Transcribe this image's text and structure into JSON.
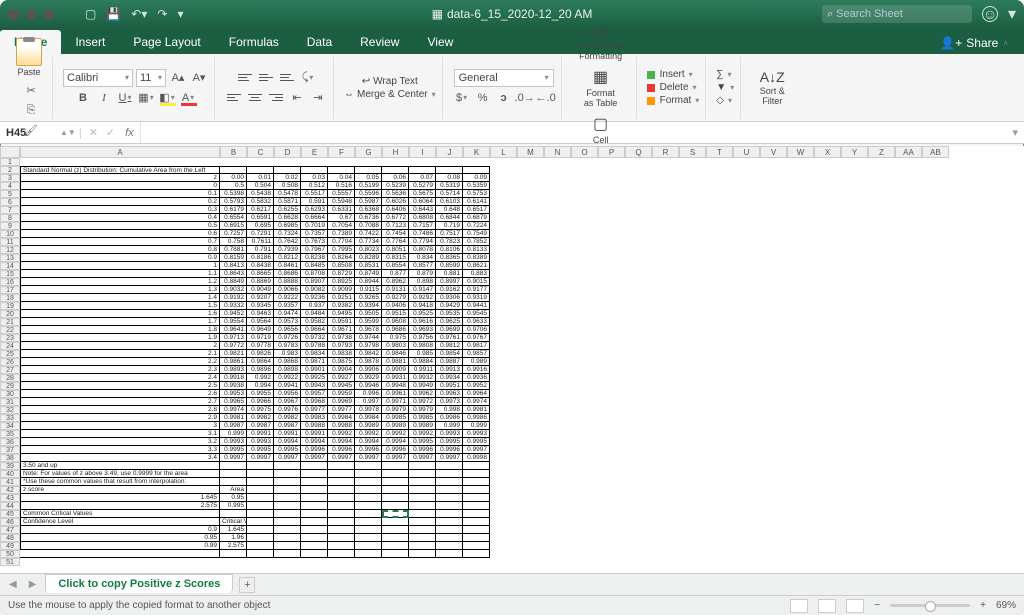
{
  "title": "data-6_15_2020-12_20 AM",
  "search_placeholder": "Search Sheet",
  "share_label": "Share",
  "tabs": [
    "Home",
    "Insert",
    "Page Layout",
    "Formulas",
    "Data",
    "Review",
    "View"
  ],
  "active_tab": "Home",
  "ribbon": {
    "paste": "Paste",
    "font_name": "Calibri",
    "font_size": "11",
    "wrap_text": "Wrap Text",
    "merge_center": "Merge & Center",
    "number_format": "General",
    "conditional_formatting": "Conditional Formatting",
    "format_as_table": "Format as Table",
    "cell_styles": "Cell Styles",
    "insert": "Insert",
    "delete": "Delete",
    "format": "Format",
    "sort_filter": "Sort & Filter"
  },
  "namebox": "H45",
  "formula": "",
  "columns": [
    "A",
    "B",
    "C",
    "D",
    "E",
    "F",
    "G",
    "H",
    "I",
    "J",
    "K",
    "L",
    "M",
    "N",
    "O",
    "P",
    "Q",
    "R",
    "S",
    "T",
    "U",
    "V",
    "W",
    "X",
    "Y",
    "Z",
    "AA",
    "AB"
  ],
  "sheet_tab": "Click to copy Positive z Scores",
  "status_text": "Use the mouse to apply the copied format to another object",
  "zoom": "69%",
  "chart_data": {
    "type": "table",
    "title": "Standard Normal (z) Distribution: Cumulative Area from the Left",
    "col_headers": [
      "z",
      "0.00",
      "0.01",
      "0.02",
      "0.03",
      "0.04",
      "0.05",
      "0.06",
      "0.07",
      "0.08",
      "0.09"
    ],
    "rows": [
      [
        "0",
        0.5,
        0.504,
        0.508,
        0.512,
        0.516,
        0.5199,
        0.5239,
        0.5279,
        0.5319,
        0.5359
      ],
      [
        "0.1",
        0.5398,
        0.5438,
        0.5478,
        0.5517,
        0.5557,
        0.5596,
        0.5636,
        0.5675,
        0.5714,
        0.5753
      ],
      [
        "0.2",
        0.5793,
        0.5832,
        0.5871,
        0.591,
        0.5948,
        0.5987,
        0.6026,
        0.6064,
        0.6103,
        0.6141
      ],
      [
        "0.3",
        0.6179,
        0.6217,
        0.6255,
        0.6293,
        0.6331,
        0.6368,
        0.6406,
        0.6443,
        0.648,
        0.6517
      ],
      [
        "0.4",
        0.6554,
        0.6591,
        0.6628,
        0.6664,
        0.67,
        0.6736,
        0.6772,
        0.6808,
        0.6844,
        0.6879
      ],
      [
        "0.5",
        0.6915,
        0.695,
        0.6985,
        0.7019,
        0.7054,
        0.7088,
        0.7123,
        0.7157,
        0.719,
        0.7224
      ],
      [
        "0.6",
        0.7257,
        0.7291,
        0.7324,
        0.7357,
        0.7389,
        0.7422,
        0.7454,
        0.7486,
        0.7517,
        0.7549
      ],
      [
        "0.7",
        0.758,
        0.7611,
        0.7642,
        0.7673,
        0.7704,
        0.7734,
        0.7764,
        0.7794,
        0.7823,
        0.7852
      ],
      [
        "0.8",
        0.7881,
        0.791,
        0.7939,
        0.7967,
        0.7995,
        0.8023,
        0.8051,
        0.8078,
        0.8106,
        0.8133
      ],
      [
        "0.9",
        0.8159,
        0.8186,
        0.8212,
        0.8238,
        0.8264,
        0.8289,
        0.8315,
        0.834,
        0.8365,
        0.8389
      ],
      [
        "1",
        0.8413,
        0.8438,
        0.8461,
        0.8485,
        0.8508,
        0.8531,
        0.8554,
        0.8577,
        0.8599,
        0.8621
      ],
      [
        "1.1",
        0.8643,
        0.8665,
        0.8686,
        0.8708,
        0.8729,
        0.8749,
        0.877,
        0.879,
        0.881,
        0.883
      ],
      [
        "1.2",
        0.8849,
        0.8869,
        0.8888,
        0.8907,
        0.8925,
        0.8944,
        0.8962,
        0.898,
        0.8997,
        0.9015
      ],
      [
        "1.3",
        0.9032,
        0.9049,
        0.9066,
        0.9082,
        0.9099,
        0.9115,
        0.9131,
        0.9147,
        0.9162,
        0.9177
      ],
      [
        "1.4",
        0.9192,
        0.9207,
        0.9222,
        0.9236,
        0.9251,
        0.9265,
        0.9279,
        0.9292,
        0.9306,
        0.9319
      ],
      [
        "1.5",
        0.9332,
        0.9345,
        0.9357,
        0.937,
        0.9382,
        0.9394,
        0.9406,
        0.9418,
        0.9429,
        0.9441
      ],
      [
        "1.6",
        0.9452,
        0.9463,
        0.9474,
        0.9484,
        0.9495,
        0.9505,
        0.9515,
        0.9525,
        0.9535,
        0.9545
      ],
      [
        "1.7",
        0.9554,
        0.9564,
        0.9573,
        0.9582,
        0.9591,
        0.9599,
        0.9608,
        0.9616,
        0.9625,
        0.9633
      ],
      [
        "1.8",
        0.9641,
        0.9649,
        0.9656,
        0.9664,
        0.9671,
        0.9678,
        0.9686,
        0.9693,
        0.9699,
        0.9706
      ],
      [
        "1.9",
        0.9713,
        0.9719,
        0.9726,
        0.9732,
        0.9738,
        0.9744,
        0.975,
        0.9756,
        0.9761,
        0.9767
      ],
      [
        "2",
        0.9772,
        0.9778,
        0.9783,
        0.9788,
        0.9793,
        0.9798,
        0.9803,
        0.9808,
        0.9812,
        0.9817
      ],
      [
        "2.1",
        0.9821,
        0.9826,
        0.983,
        0.9834,
        0.9838,
        0.9842,
        0.9846,
        0.985,
        0.9854,
        0.9857
      ],
      [
        "2.2",
        0.9861,
        0.9864,
        0.9868,
        0.9871,
        0.9875,
        0.9878,
        0.9881,
        0.9884,
        0.9887,
        0.989
      ],
      [
        "2.3",
        0.9893,
        0.9896,
        0.9898,
        0.9901,
        0.9904,
        0.9906,
        0.9909,
        0.9911,
        0.9913,
        0.9916
      ],
      [
        "2.4",
        0.9918,
        0.992,
        0.9922,
        0.9925,
        0.9927,
        0.9929,
        0.9931,
        0.9932,
        0.9934,
        0.9936
      ],
      [
        "2.5",
        0.9938,
        0.994,
        0.9941,
        0.9943,
        0.9945,
        0.9946,
        0.9948,
        0.9949,
        0.9951,
        0.9952
      ],
      [
        "2.6",
        0.9953,
        0.9955,
        0.9956,
        0.9957,
        0.9959,
        0.996,
        0.9961,
        0.9962,
        0.9963,
        0.9964
      ],
      [
        "2.7",
        0.9965,
        0.9966,
        0.9967,
        0.9968,
        0.9969,
        0.997,
        0.9971,
        0.9972,
        0.9973,
        0.9974
      ],
      [
        "2.8",
        0.9974,
        0.9975,
        0.9976,
        0.9977,
        0.9977,
        0.9978,
        0.9979,
        0.9979,
        0.998,
        0.9981
      ],
      [
        "2.9",
        0.9981,
        0.9982,
        0.9982,
        0.9983,
        0.9984,
        0.9984,
        0.9985,
        0.9985,
        0.9986,
        0.9986
      ],
      [
        "3",
        0.9987,
        0.9987,
        0.9987,
        0.9988,
        0.9988,
        0.9989,
        0.9989,
        0.9989,
        0.999,
        0.999
      ],
      [
        "3.1",
        0.999,
        0.9991,
        0.9991,
        0.9991,
        0.9992,
        0.9992,
        0.9992,
        0.9992,
        0.9993,
        0.9993
      ],
      [
        "3.2",
        0.9993,
        0.9993,
        0.9994,
        0.9994,
        0.9994,
        0.9994,
        0.9994,
        0.9995,
        0.9995,
        0.9995
      ],
      [
        "3.3",
        0.9995,
        0.9995,
        0.9995,
        0.9996,
        0.9996,
        0.9996,
        0.9996,
        0.9996,
        0.9996,
        0.9997
      ],
      [
        "3.4",
        0.9997,
        0.9997,
        0.9997,
        0.9997,
        0.9997,
        0.9997,
        0.9997,
        0.9997,
        0.9997,
        0.9998
      ]
    ],
    "notes": [
      "3.50 and up",
      "Note: For values of z above 3.49, use 0.9999 for the area",
      "*Use these common values that result from interpolation:"
    ],
    "interp": {
      "z_label": "z score",
      "area_label": "Area",
      "rows": [
        [
          "1.645",
          "0.95"
        ],
        [
          "2.575",
          "0.995"
        ]
      ]
    },
    "critical": {
      "header": "Common Critical Values",
      "conf_label": "Confidence Level",
      "val_label": "Critical Value",
      "rows": [
        [
          "0.9",
          "1.645"
        ],
        [
          "0.95",
          "1.96"
        ],
        [
          "0.99",
          "2.575"
        ]
      ]
    }
  }
}
